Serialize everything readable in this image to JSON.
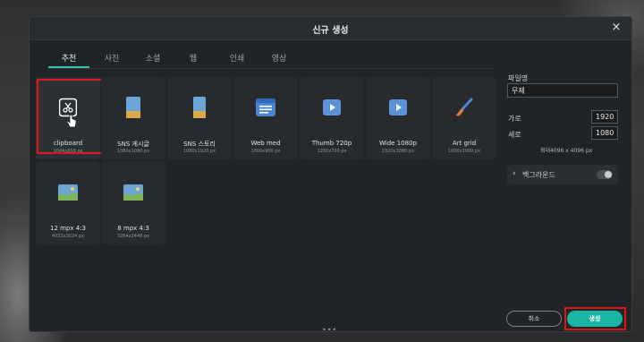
{
  "dialog": {
    "title": "신규 생성",
    "close_label": "×"
  },
  "tabs": [
    {
      "label": "추천"
    },
    {
      "label": "사진"
    },
    {
      "label": "소셜"
    },
    {
      "label": "웹"
    },
    {
      "label": "인쇄"
    },
    {
      "label": "영상"
    }
  ],
  "presets": [
    {
      "name": "clipboard",
      "size": "1044x859 px",
      "icon": "scissors-icon"
    },
    {
      "name": "SNS 게시글",
      "size": "1080x1080 px",
      "icon": "portrait-image-icon"
    },
    {
      "name": "SNS 스토리",
      "size": "1080x1920 px",
      "icon": "portrait-image-icon"
    },
    {
      "name": "Web med",
      "size": "1600x900 px",
      "icon": "web-page-icon"
    },
    {
      "name": "Thumb 720p",
      "size": "1280x720 px",
      "icon": "play-video-icon"
    },
    {
      "name": "Wide 1080p",
      "size": "1920x1080 px",
      "icon": "play-video-icon"
    },
    {
      "name": "Art grid",
      "size": "1000x1000 px",
      "icon": "paintbrush-icon"
    },
    {
      "name": "12 mpx 4:3",
      "size": "4032x3024 px",
      "icon": "landscape-image-icon"
    },
    {
      "name": "8 mpx 4:3",
      "size": "3264x2448 px",
      "icon": "landscape-image-icon"
    }
  ],
  "side": {
    "filename_label": "파일명",
    "filename_value": "무제",
    "width_label": "가로",
    "width_value": "1920",
    "height_label": "세로",
    "height_value": "1080",
    "max_info": "최대4096 x 4096 px",
    "background_label": "백그라운드",
    "background_on": false
  },
  "buttons": {
    "cancel": "취소",
    "create": "생성"
  },
  "footer": {
    "dots": "•••"
  },
  "colors": {
    "accent": "#19b6a6",
    "highlight": "#e0161b",
    "dialog_bg": "#212426"
  }
}
